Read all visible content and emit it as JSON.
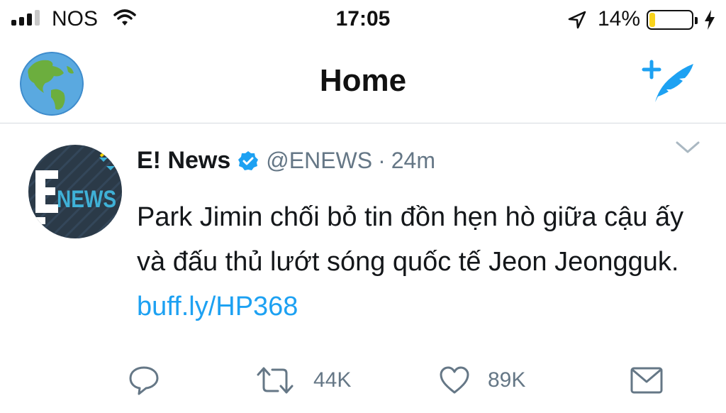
{
  "status_bar": {
    "carrier": "NOS",
    "time": "17:05",
    "battery_percent": "14%",
    "battery_level": 0.14,
    "signal_bars": 3,
    "signal_max": 4
  },
  "header": {
    "title": "Home",
    "avatar_icon": "globe-icon",
    "compose_icon": "compose-feather-icon"
  },
  "tweet": {
    "author_name": "E! News",
    "verified": true,
    "handle": "@ENEWS",
    "separator": "·",
    "time": "24m",
    "avatar_text": "NEWS",
    "text": "Park Jimin chối bỏ tin đồn hẹn hò giữa cậu ấy và đấu thủ lướt sóng quốc tế Jeon Jeongguk. ",
    "link": "buff.ly/HP368",
    "actions": {
      "retweet_count": "44K",
      "like_count": "89K"
    }
  },
  "colors": {
    "accent": "#1da1f2",
    "text": "#14171a",
    "secondary": "#657786",
    "battery": "#f8d31c",
    "avatar_bg": "#2b3a48"
  }
}
